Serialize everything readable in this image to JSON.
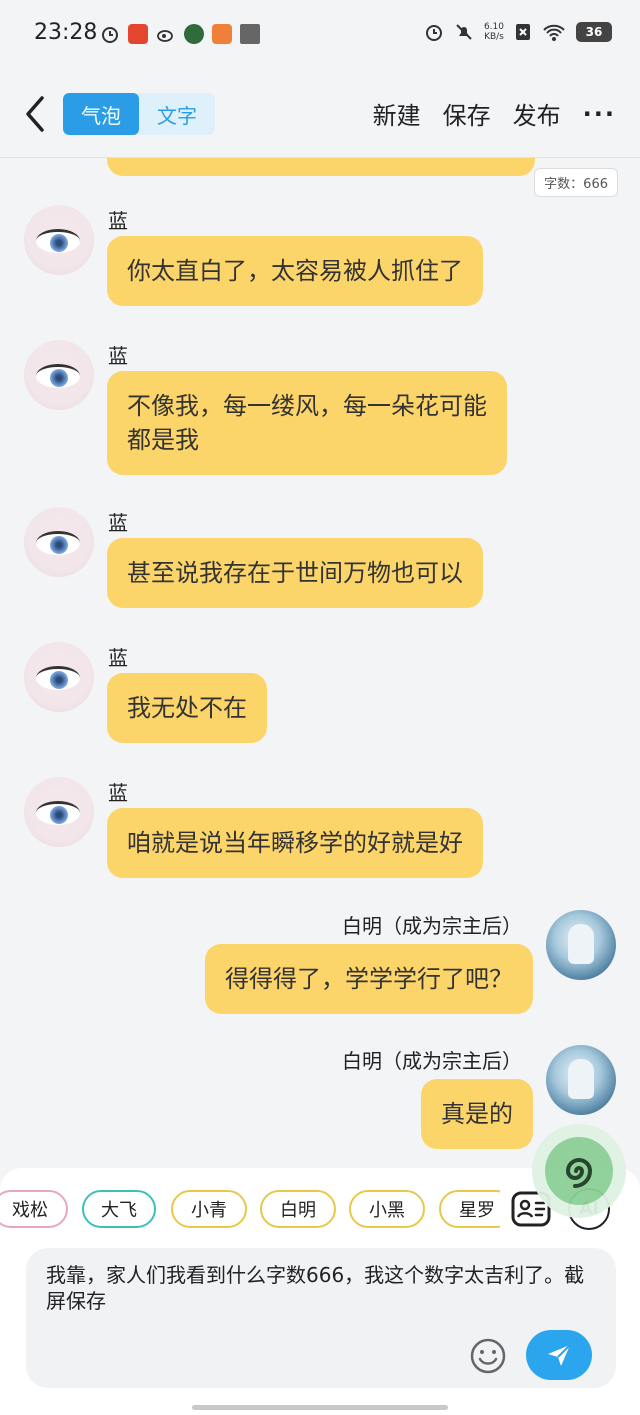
{
  "status_bar": {
    "time": "23:28",
    "net_speed_value": "6.10",
    "net_speed_unit": "KB/s",
    "battery": "36"
  },
  "header": {
    "tab_bubble": "气泡",
    "tab_text": "文字",
    "new_label": "新建",
    "save_label": "保存",
    "publish_label": "发布",
    "more_label": "···"
  },
  "chat": {
    "word_count": "字数：666",
    "messages": [
      {
        "side": "left",
        "sender": "蓝",
        "lines": [
          "你太直白了，太容易被人抓住了"
        ]
      },
      {
        "side": "left",
        "sender": "蓝",
        "lines": [
          "不像我，每一缕风，每一朵花可能",
          "都是我"
        ]
      },
      {
        "side": "left",
        "sender": "蓝",
        "lines": [
          "甚至说我存在于世间万物也可以"
        ]
      },
      {
        "side": "left",
        "sender": "蓝",
        "lines": [
          "我无处不在"
        ]
      },
      {
        "side": "left",
        "sender": "蓝",
        "lines": [
          "咱就是说当年瞬移学的好就是好"
        ]
      },
      {
        "side": "right",
        "sender": "白明（成为宗主后）",
        "lines": [
          "得得得了，学学学行了吧？"
        ]
      },
      {
        "side": "right",
        "sender": "白明（成为宗主后）",
        "lines": [
          "真是的"
        ]
      }
    ]
  },
  "characters": [
    "戏松",
    "大飞",
    "小青",
    "白明",
    "小黑",
    "星罗"
  ],
  "tools": {
    "ai_label": "AI"
  },
  "input": {
    "value": "我靠，家人们我看到什么字数666，我这个数字太吉利了。截屏保存"
  },
  "colors": {
    "bubble": "#fcd56a",
    "accent": "#2a9de6",
    "send": "#2aa5ee"
  }
}
